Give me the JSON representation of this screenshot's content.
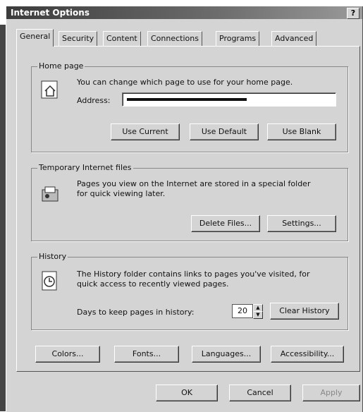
{
  "window": {
    "title": "Internet Options",
    "help_label": "?"
  },
  "tabs": [
    {
      "label": "General"
    },
    {
      "label": "Security"
    },
    {
      "label": "Content"
    },
    {
      "label": "Connections"
    },
    {
      "label": "Programs"
    },
    {
      "label": "Advanced"
    }
  ],
  "home_page": {
    "group_label": "Home page",
    "description": "You can change which page to use for your home page.",
    "address_label": "Address:",
    "address_value": "",
    "buttons": {
      "use_current": "Use Current",
      "use_default": "Use Default",
      "use_blank": "Use Blank"
    }
  },
  "temp_files": {
    "group_label": "Temporary Internet files",
    "description_line1": "Pages you view on the Internet are stored in a special folder",
    "description_line2": "for quick viewing later.",
    "buttons": {
      "delete_files": "Delete Files...",
      "settings": "Settings..."
    }
  },
  "history": {
    "group_label": "History",
    "description_line1": "The History folder contains links to pages you've visited, for",
    "description_line2": "quick access to recently viewed pages.",
    "days_label": "Days to keep pages in history:",
    "days_value": "20",
    "clear_button": "Clear History"
  },
  "bottom_buttons": {
    "colors": "Colors...",
    "fonts": "Fonts...",
    "languages": "Languages...",
    "accessibility": "Accessibility..."
  },
  "dialog_buttons": {
    "ok": "OK",
    "cancel": "Cancel",
    "apply": "Apply"
  }
}
